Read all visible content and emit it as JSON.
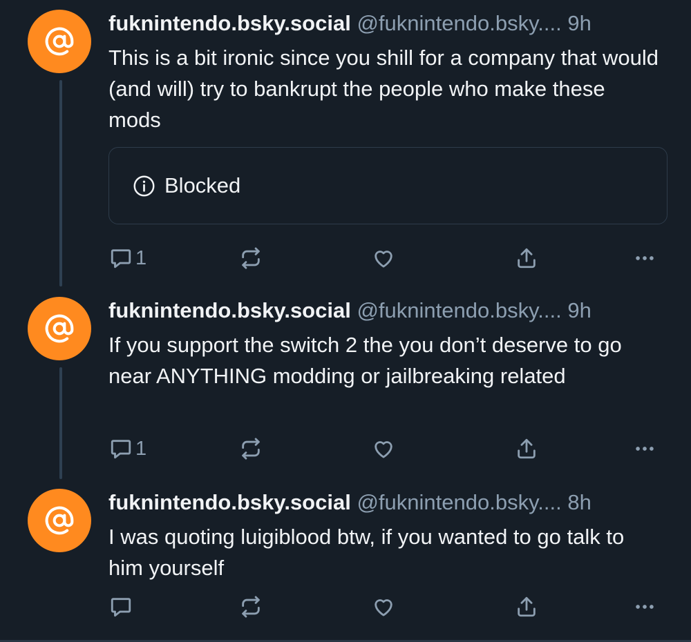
{
  "posts": [
    {
      "display_name": "fuknintendo.bsky.social",
      "handle": "@fuknintendo.bsky....",
      "time": "9h",
      "text": "This is a bit ironic since you shill for a company that would (and will) try to bankrupt the people who make these mods",
      "embed": {
        "icon": "info-circle-icon",
        "label": "Blocked"
      },
      "reply_count": "1"
    },
    {
      "display_name": "fuknintendo.bsky.social",
      "handle": "@fuknintendo.bsky....",
      "time": "9h",
      "text": "If you support the switch 2 the you don’t deserve to go near ANYTHING modding or jailbreaking related",
      "reply_count": "1"
    },
    {
      "display_name": "fuknintendo.bsky.social",
      "handle": "@fuknintendo.bsky....",
      "time": "8h",
      "text": "I was quoting luigiblood btw, if you wanted to go talk to him yourself",
      "reply_count": ""
    }
  ],
  "colors": {
    "background": "#161e27",
    "avatar": "#ff8a1f",
    "muted_text": "#8d9fb1",
    "thread_line": "#2e4052"
  },
  "icons": [
    "at-sign-icon",
    "info-circle-icon",
    "reply-icon",
    "repost-icon",
    "like-icon",
    "share-icon",
    "more-icon"
  ]
}
